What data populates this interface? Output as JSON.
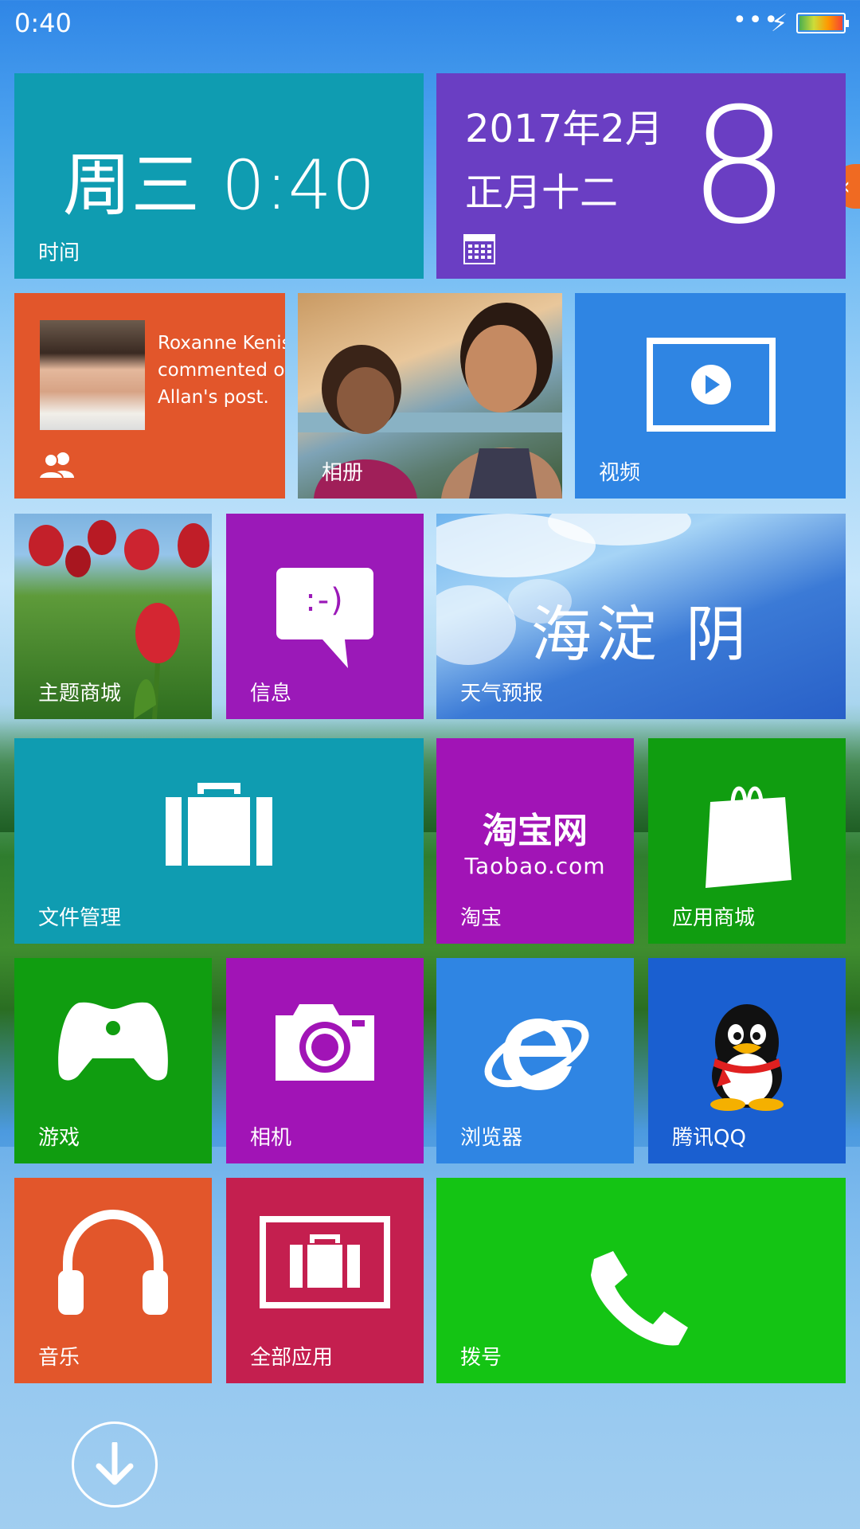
{
  "status_bar": {
    "time": "0:40",
    "more": "•••"
  },
  "tiles": {
    "time": {
      "display": "周三  0:40",
      "label": "时间"
    },
    "calendar": {
      "year_month": "2017年2月",
      "lunar": "正月十二",
      "day": "8"
    },
    "people": {
      "line1": "Roxanne Kenis",
      "line2": "commented o",
      "line3": "Allan's post."
    },
    "album": {
      "label": "相册"
    },
    "video": {
      "label": "视频"
    },
    "theme": {
      "label": "主题商城"
    },
    "message": {
      "label": "信息",
      "emoticon": ":-)"
    },
    "weather": {
      "text": "海淀  阴",
      "label": "天气预报"
    },
    "files": {
      "label": "文件管理"
    },
    "taobao": {
      "logo_cn": "淘宝网",
      "logo_en": "Taobao.com",
      "label": "淘宝"
    },
    "store": {
      "label": "应用商城"
    },
    "game": {
      "label": "游戏"
    },
    "camera": {
      "label": "相机"
    },
    "browser": {
      "label": "浏览器"
    },
    "qq": {
      "label": "腾讯QQ"
    },
    "music": {
      "label": "音乐"
    },
    "allapps": {
      "label": "全部应用"
    },
    "dial": {
      "label": "拨号"
    }
  },
  "colors": {
    "teal": "#0f9cb1",
    "purple_cal": "#6a3ec3",
    "orange": "#e2562b",
    "blue": "#2f85e3",
    "magenta": "#a114b6",
    "green": "#109d10",
    "crimson": "#c41f4f",
    "lime": "#14c414",
    "edge_tab": "#f06a22"
  }
}
